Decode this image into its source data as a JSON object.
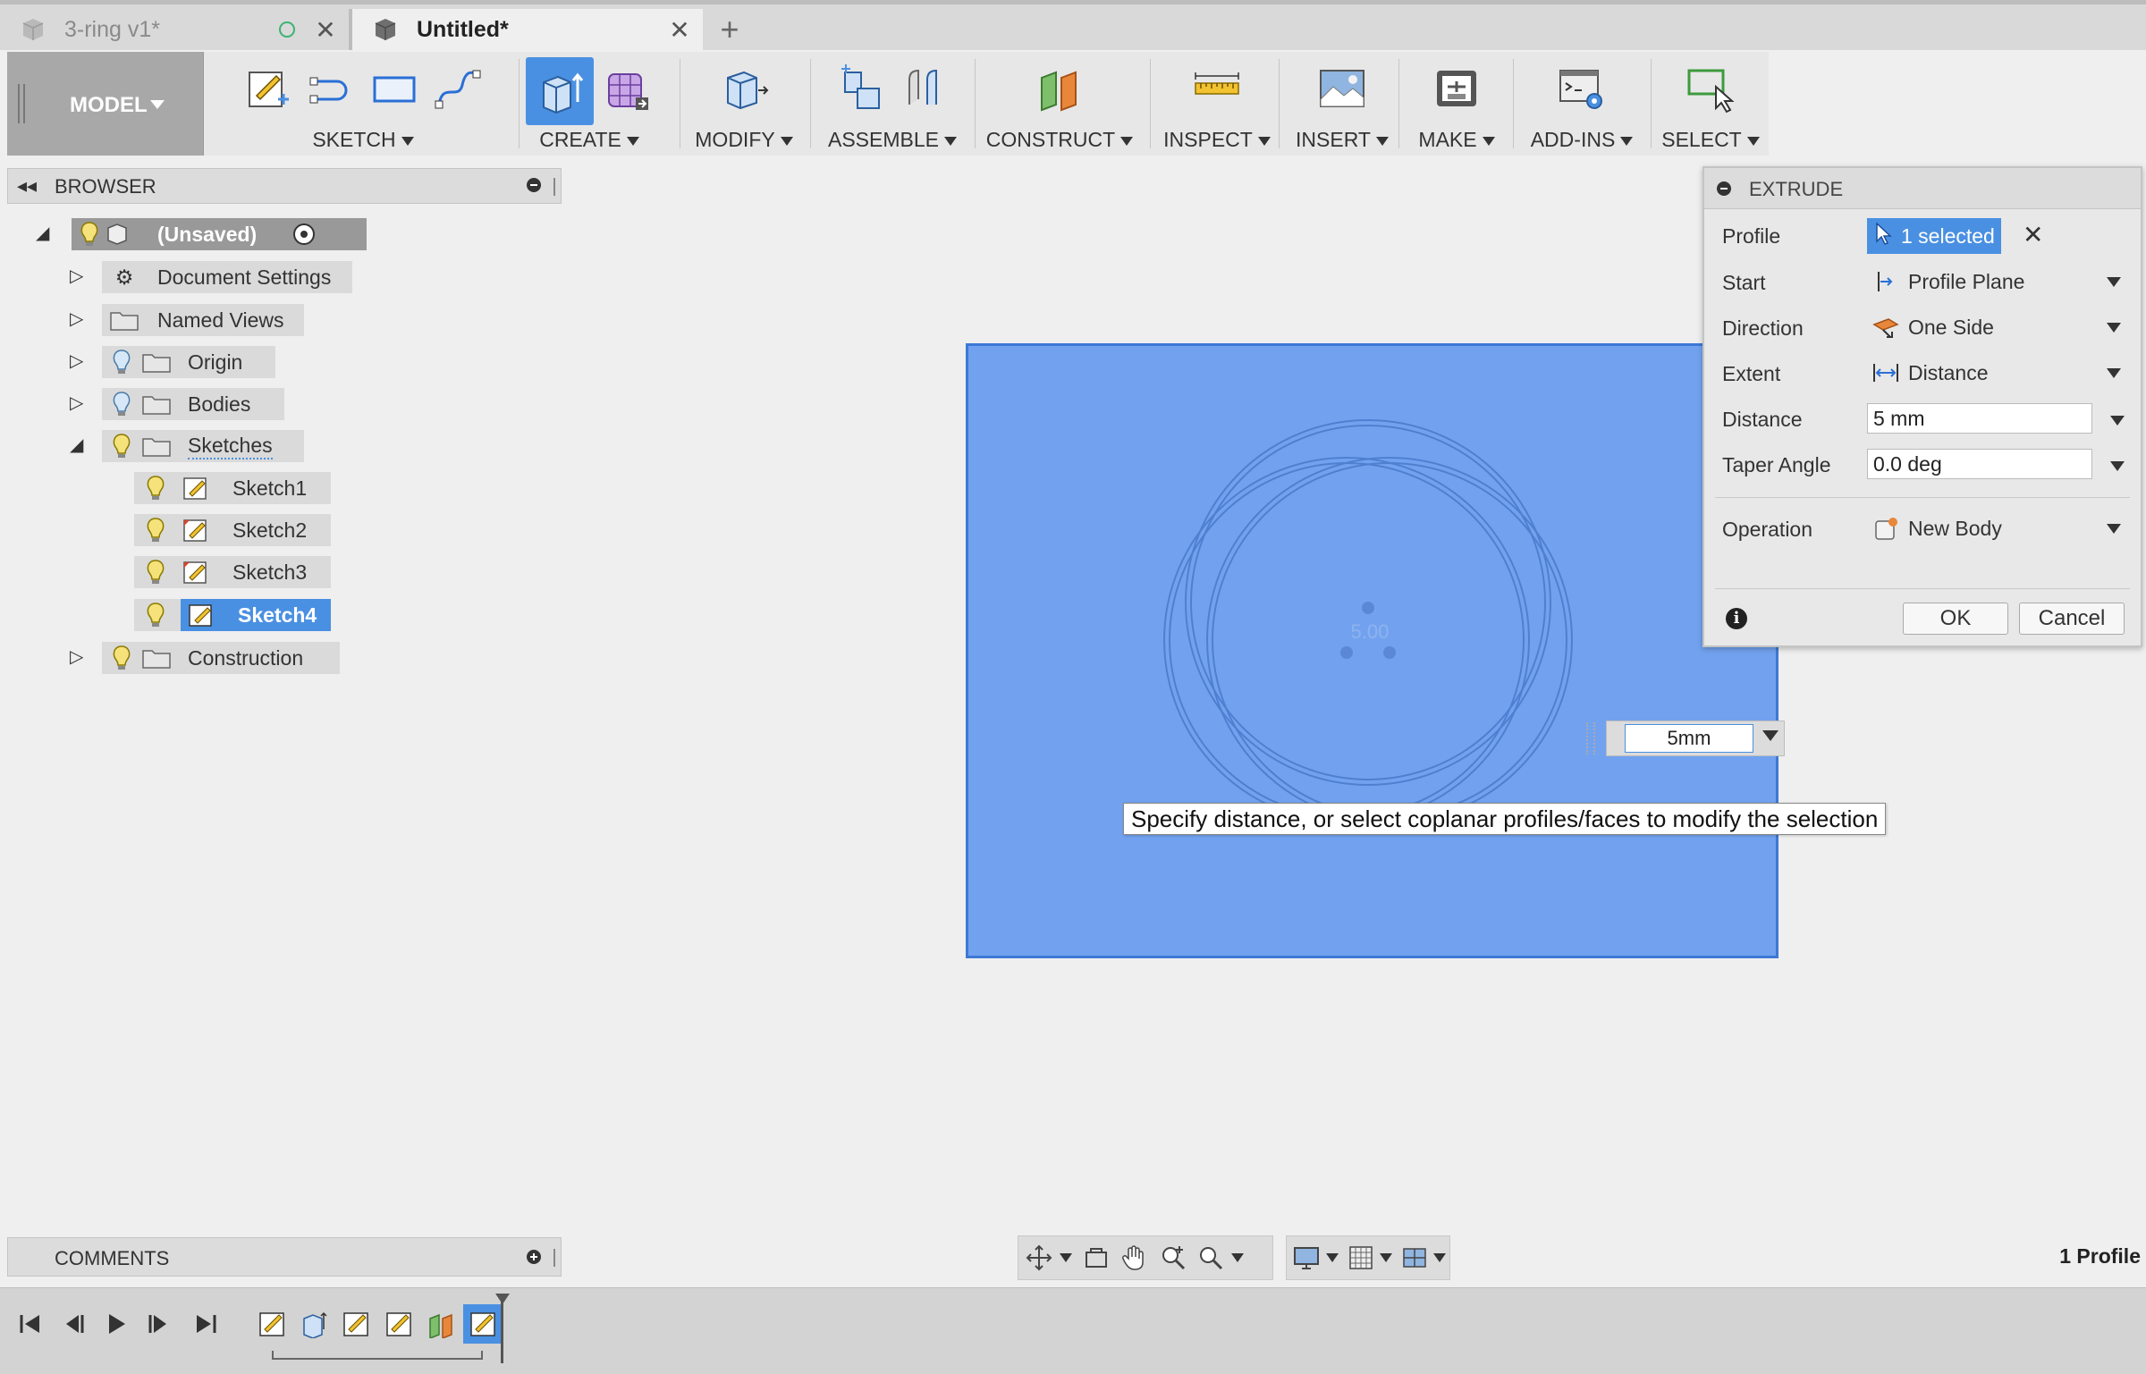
{
  "tabs": [
    {
      "label": "3-ring v1*",
      "active": false
    },
    {
      "label": "Untitled*",
      "active": true
    }
  ],
  "toolbar": {
    "workspace_label": "MODEL",
    "groups": [
      {
        "label": "SKETCH"
      },
      {
        "label": "CREATE"
      },
      {
        "label": "MODIFY"
      },
      {
        "label": "ASSEMBLE"
      },
      {
        "label": "CONSTRUCT"
      },
      {
        "label": "INSPECT"
      },
      {
        "label": "INSERT"
      },
      {
        "label": "MAKE"
      },
      {
        "label": "ADD-INS"
      },
      {
        "label": "SELECT"
      }
    ]
  },
  "browser": {
    "title": "BROWSER",
    "root_label": "(Unsaved)",
    "nodes": [
      {
        "label": "Document Settings"
      },
      {
        "label": "Named Views"
      },
      {
        "label": "Origin"
      },
      {
        "label": "Bodies"
      },
      {
        "label": "Sketches"
      },
      {
        "label": "Sketch1"
      },
      {
        "label": "Sketch2"
      },
      {
        "label": "Sketch3"
      },
      {
        "label": "Sketch4"
      },
      {
        "label": "Construction"
      }
    ]
  },
  "extrude": {
    "title": "EXTRUDE",
    "profile_label": "Profile",
    "profile_value": "1 selected",
    "start_label": "Start",
    "start_value": "Profile Plane",
    "direction_label": "Direction",
    "direction_value": "One Side",
    "extent_label": "Extent",
    "extent_value": "Distance",
    "distance_label": "Distance",
    "distance_value": "5 mm",
    "taper_label": "Taper Angle",
    "taper_value": "0.0 deg",
    "operation_label": "Operation",
    "operation_value": "New Body",
    "ok_label": "OK",
    "cancel_label": "Cancel"
  },
  "viewport": {
    "dimension_input": "5mm",
    "tooltip": "Specify distance, or select coplanar profiles/faces to modify the selection",
    "sketch_center_text": "5.00"
  },
  "comments": {
    "title": "COMMENTS"
  },
  "status": {
    "profile_count": "1 Profile"
  },
  "colors": {
    "accent": "#4a90e2",
    "sketch_plane": "#72a2ef",
    "workspace_bg": "#a8a8a8"
  }
}
